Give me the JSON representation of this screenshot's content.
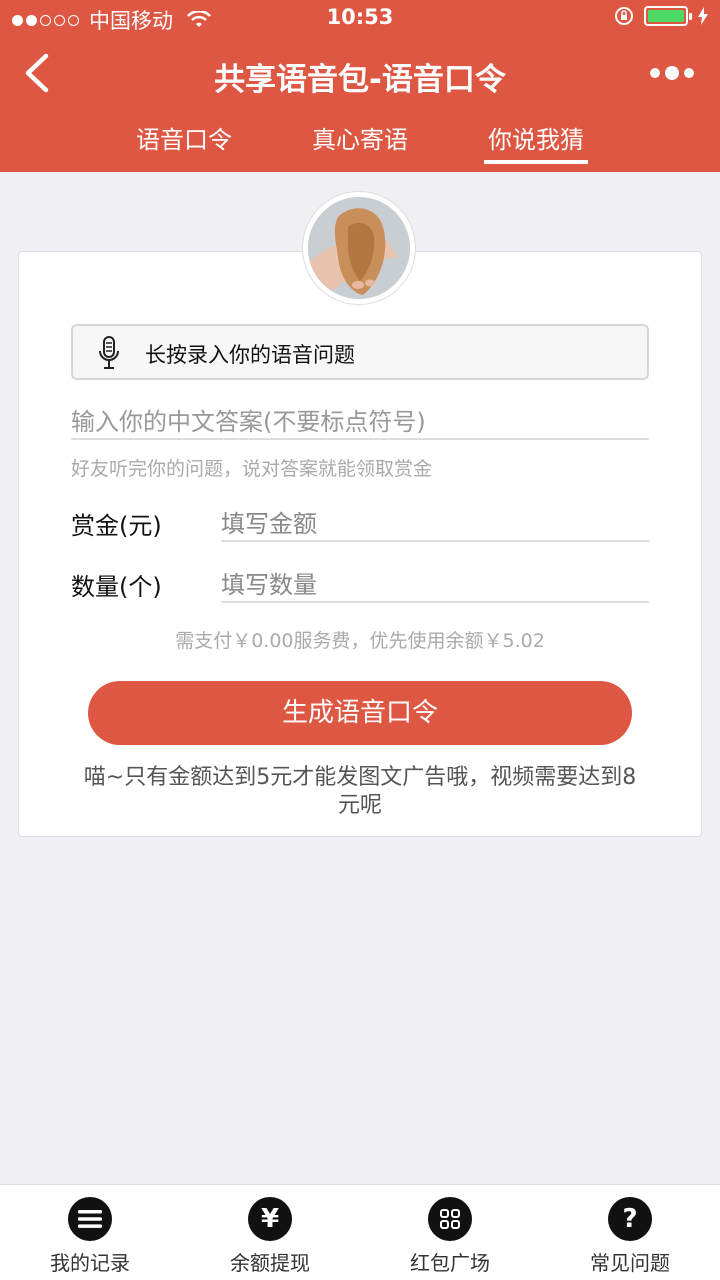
{
  "status_bar": {
    "carrier": "中国移动",
    "time": "10:53"
  },
  "navbar": {
    "title": "共享语音包-语音口令"
  },
  "tabs": [
    {
      "label": "语音口令"
    },
    {
      "label": "真心寄语"
    },
    {
      "label": "你说我猜",
      "active": true
    }
  ],
  "form": {
    "record_label": "长按录入你的语音问题",
    "answer_placeholder": "输入你的中文答案(不要标点符号)",
    "hint": "好友听完你的问题，说对答案就能领取赏金",
    "reward_label": "赏金(元)",
    "reward_placeholder": "填写金额",
    "quantity_label": "数量(个)",
    "quantity_placeholder": "填写数量",
    "fee_text": "需支付￥0.00服务费，优先使用余额￥5.02",
    "generate_button": "生成语音口令",
    "notice": "喵~只有金额达到5元才能发图文广告哦，视频需要达到8元呢"
  },
  "bottom_nav": [
    {
      "label": "我的记录",
      "icon": "menu-list-icon"
    },
    {
      "label": "余额提现",
      "icon": "yen-icon"
    },
    {
      "label": "红包广场",
      "icon": "grid-icon"
    },
    {
      "label": "常见问题",
      "icon": "question-icon"
    }
  ],
  "colors": {
    "primary": "#dd5743",
    "background": "#efeff4",
    "battery": "#4cd964"
  }
}
